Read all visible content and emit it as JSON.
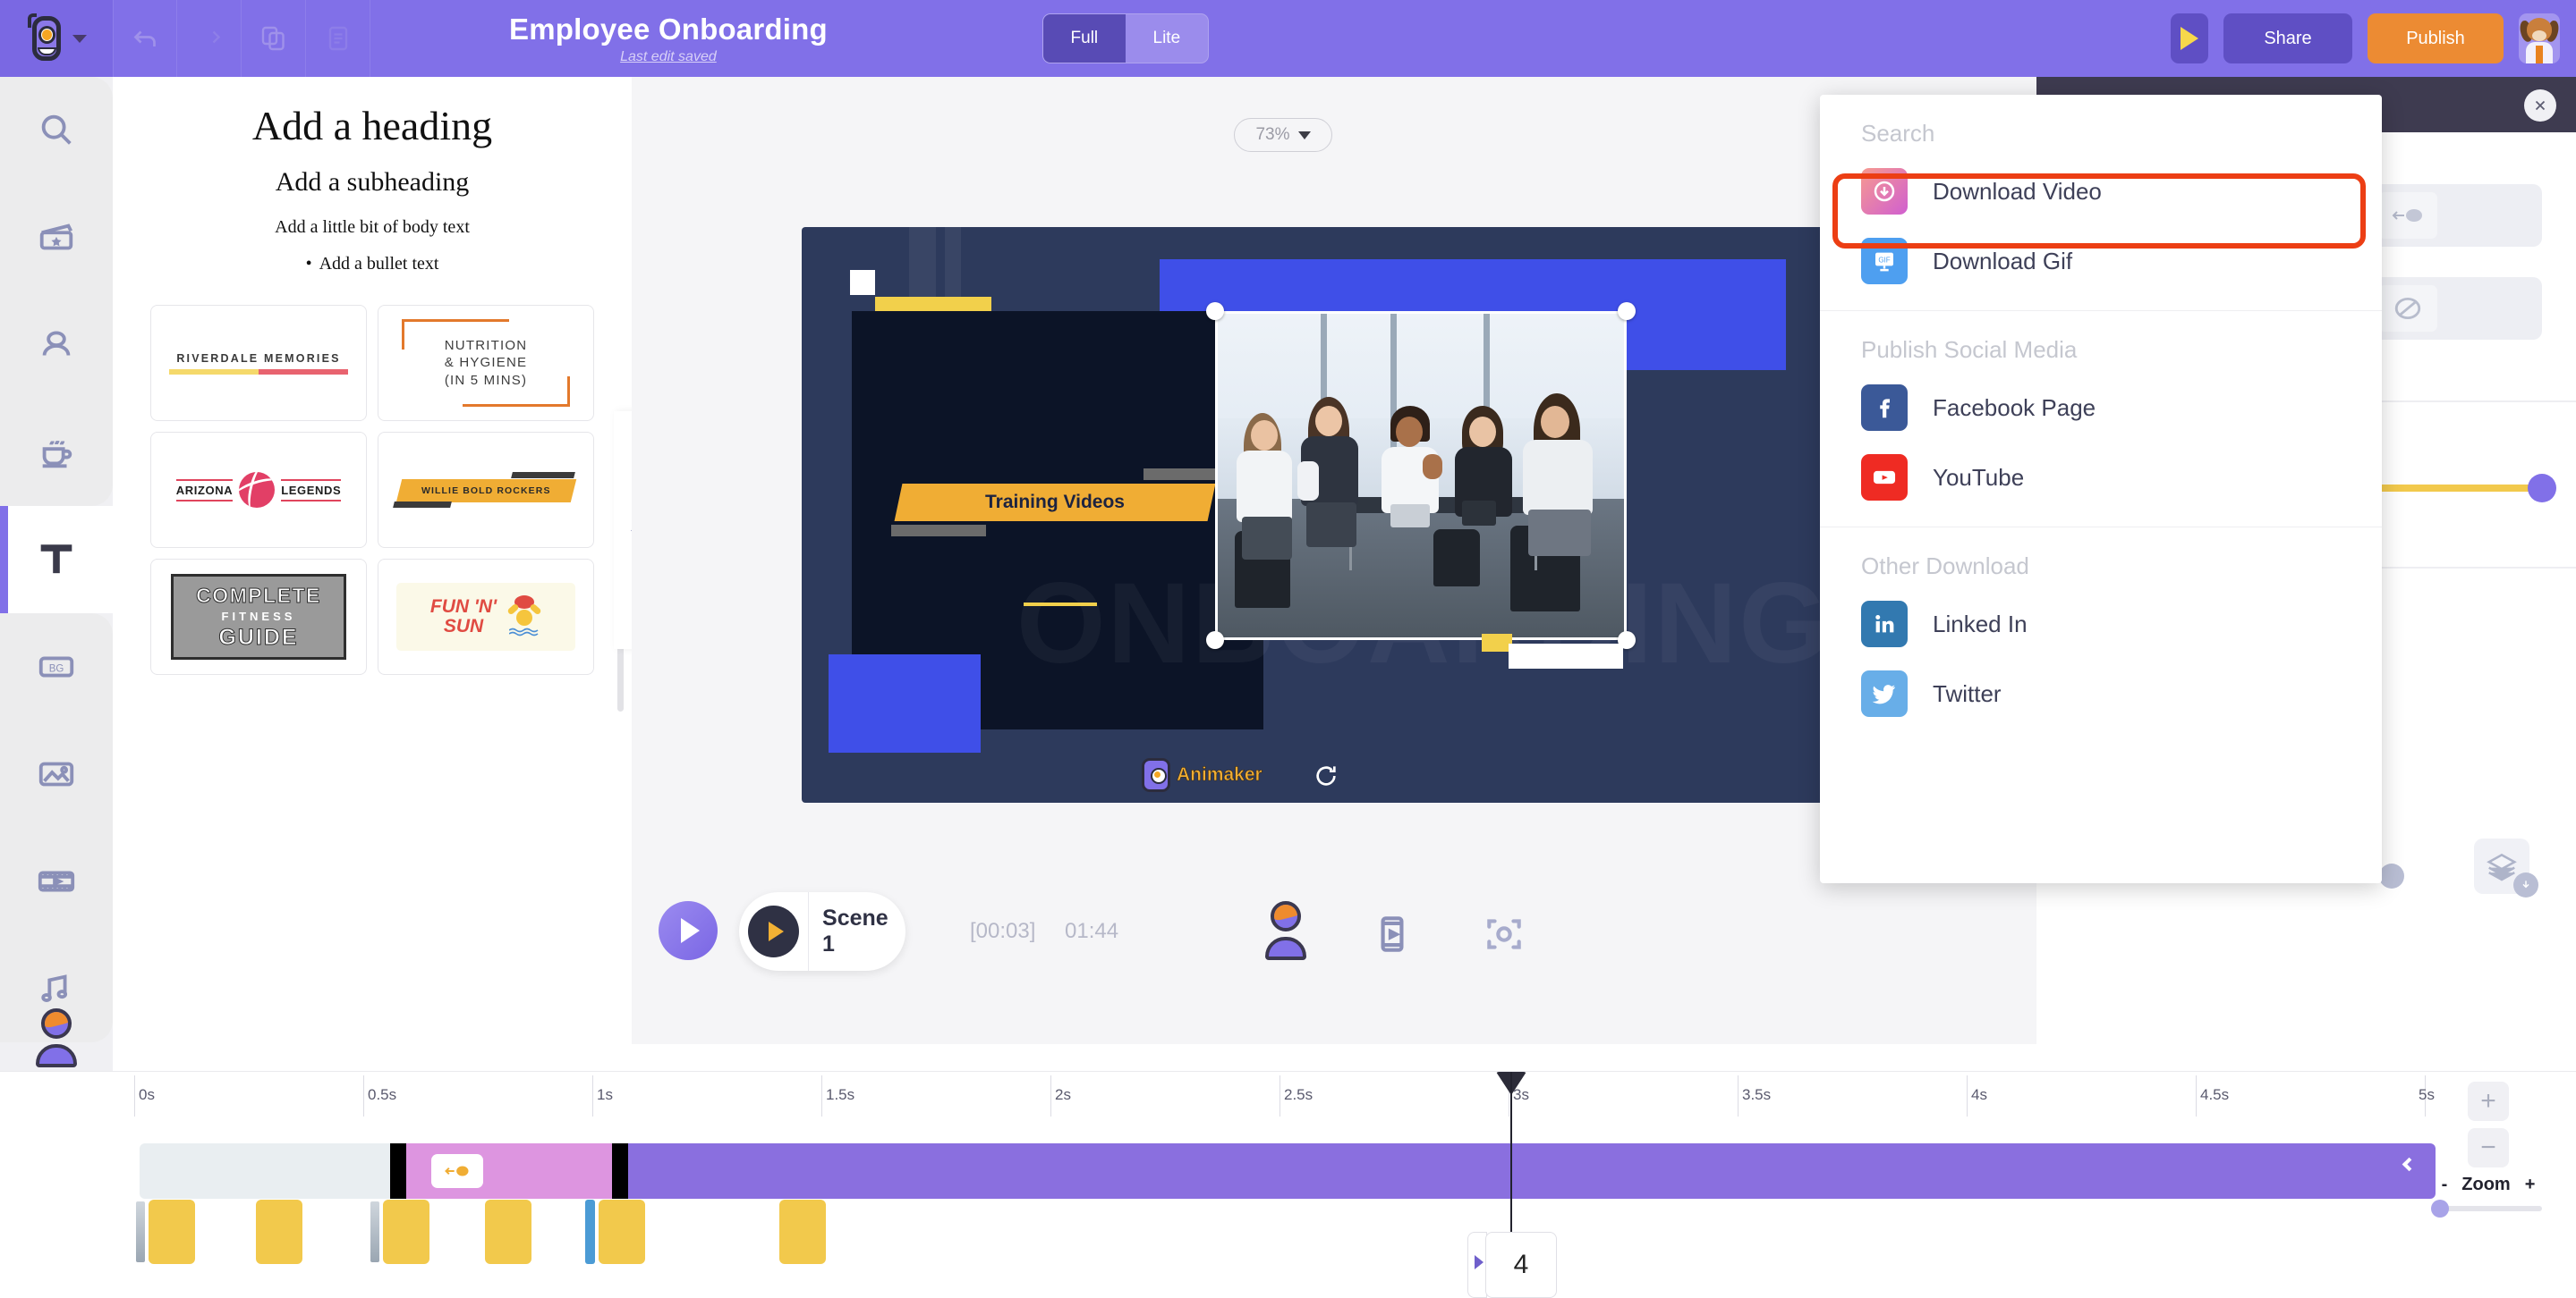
{
  "topbar": {
    "undo_icon": "undo-icon",
    "copy_icon": "duplicate-icon",
    "layout_icon": "layout-icon",
    "title": "Employee Onboarding",
    "save_status": "Last edit saved",
    "mode_toggle": {
      "options": [
        "Full",
        "Lite"
      ],
      "selected": "Lite"
    },
    "preview_icon": "play-icon",
    "share_label": "Share",
    "publish_label": "Publish",
    "avatar": "user-avatar"
  },
  "left_rail": {
    "items": [
      {
        "name": "search",
        "icon": "search-icon",
        "active": false
      },
      {
        "name": "templates",
        "icon": "clapperboard-star-icon",
        "active": false
      },
      {
        "name": "characters",
        "icon": "character-icon",
        "active": false
      },
      {
        "name": "props",
        "icon": "coffee-cup-icon",
        "active": false
      },
      {
        "name": "text",
        "icon": "text-t-icon",
        "active": true
      },
      {
        "name": "background",
        "icon": "bg-icon",
        "active": false
      },
      {
        "name": "images",
        "icon": "image-icon",
        "active": false
      },
      {
        "name": "video",
        "icon": "film-strip-icon",
        "active": false
      },
      {
        "name": "music",
        "icon": "music-note-icon",
        "active": false
      }
    ],
    "bottom_avatar": "character-avatar-icon"
  },
  "text_panel": {
    "heading": "Add a heading",
    "subheading": "Add a subheading",
    "body": "Add a little bit of body text",
    "bullet": "Add a bullet text",
    "presets": [
      {
        "id": "riverdale",
        "text": "RIVERDALE MEMORIES"
      },
      {
        "id": "nutrition",
        "line1": "NUTRITION",
        "line2": "& HYGIENE",
        "line3": "(IN 5 MINS)"
      },
      {
        "id": "arizona",
        "left": "ARIZONA",
        "right": "LEGENDS"
      },
      {
        "id": "willie",
        "text": "WILLIE BOLD ROCKERS"
      },
      {
        "id": "fitness",
        "line1": "COMPLETE",
        "line2": "FITNESS",
        "line3": "GUIDE"
      },
      {
        "id": "funsun",
        "line1": "FUN 'N'",
        "line2": "SUN"
      }
    ],
    "collapse_icon": "chevron-left-icon"
  },
  "canvas": {
    "zoom_level": "73%",
    "zoom_caret": "chevron-down-icon",
    "stage": {
      "label": "Training Videos",
      "ghost_text": "ONBOARDING",
      "watermark": "Animaker",
      "rotate_icon": "rotate-icon"
    }
  },
  "right_panel": {
    "close_icon": "close-icon",
    "entry_effect_icon": "arrow-in-icon",
    "exit_effect_icon": "no-effect-icon",
    "layers_icon": "layers-icon",
    "layers_badge_icon": "download-arrow-icon"
  },
  "scene_bar": {
    "play_icon": "play-icon",
    "scene_play_icon": "play-icon",
    "scene_label": "Scene 1",
    "current_time": "[00:03]",
    "total_time": "01:44",
    "character_icon": "character-icon",
    "film_icon": "film-icon",
    "focus_icon": "focus-icon"
  },
  "timeline": {
    "ticks": [
      "0s",
      "0.5s",
      "1s",
      "1.5s",
      "2s",
      "2.5s",
      "3s",
      "3.5s",
      "4s",
      "4.5s",
      "5s"
    ],
    "frame_number": "4",
    "track_collapse_icon": "chevron-left-icon",
    "zoom_in_icon": "plus-icon",
    "zoom_out_icon": "minus-icon",
    "zoom_label": "Zoom",
    "zoom_minus": "-",
    "zoom_plus": "+"
  },
  "dropdown": {
    "groups": [
      {
        "label": "Search",
        "items": [
          {
            "label": "Download Video",
            "icon": "download-video-icon",
            "highlighted": true
          },
          {
            "label": "Download Gif",
            "icon": "download-gif-icon",
            "highlighted": false
          }
        ]
      },
      {
        "label": "Publish Social Media",
        "items": [
          {
            "label": "Facebook Page",
            "icon": "facebook-icon",
            "highlighted": false
          },
          {
            "label": "YouTube",
            "icon": "youtube-icon",
            "highlighted": false
          }
        ]
      },
      {
        "label": "Other Download",
        "items": [
          {
            "label": "Linked In",
            "icon": "linkedin-icon",
            "highlighted": false
          },
          {
            "label": "Twitter",
            "icon": "twitter-icon",
            "highlighted": false
          }
        ]
      }
    ],
    "highlight_color": "#ec3e14"
  },
  "colors": {
    "brand_purple": "#8170e8",
    "publish_orange": "#ec8b33",
    "accent_yellow": "#f2c94c",
    "highlight_red": "#ec3e14"
  }
}
